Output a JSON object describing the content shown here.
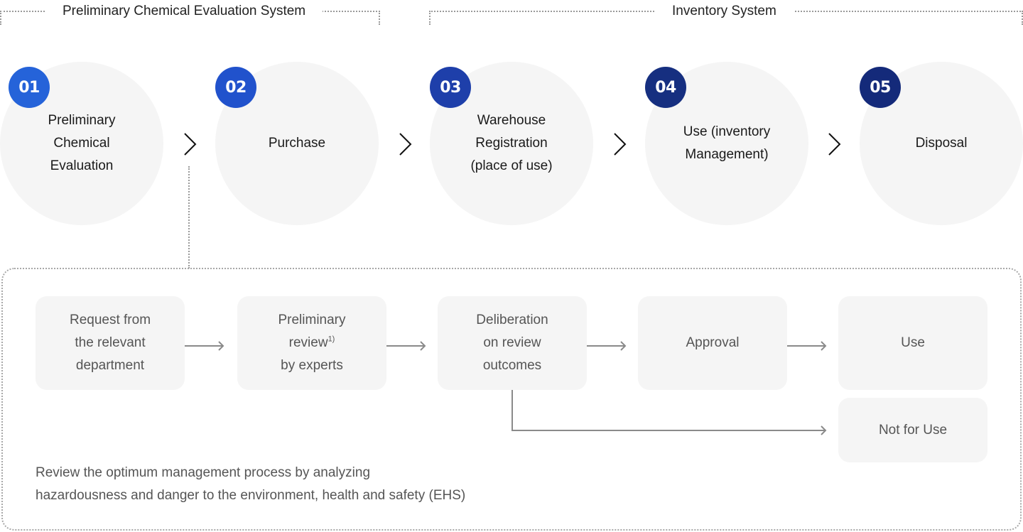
{
  "brackets": {
    "preliminary_system": "Preliminary Chemical Evaluation System",
    "inventory_system": "Inventory System"
  },
  "steps": [
    {
      "number": "01",
      "label": "Preliminary\nChemical\nEvaluation",
      "badge_color": "#2563d9"
    },
    {
      "number": "02",
      "label": "Purchase",
      "badge_color": "#2152cc"
    },
    {
      "number": "03",
      "label": "Warehouse\nRegistration\n(place of use)",
      "badge_color": "#1e3faa"
    },
    {
      "number": "04",
      "label": "Use (inventory\nManagement)",
      "badge_color": "#162f80"
    },
    {
      "number": "05",
      "label": "Disposal",
      "badge_color": "#142a7a"
    }
  ],
  "sub_process": {
    "boxes": [
      {
        "label": "Request from\nthe relevant\ndepartment"
      },
      {
        "label_pre": "Preliminary\nreview",
        "superscript": "1)",
        "label_post": "\nby experts"
      },
      {
        "label": "Deliberation\non review\noutcomes"
      },
      {
        "label": "Approval"
      },
      {
        "label": "Use"
      },
      {
        "label": "Not for Use"
      }
    ],
    "note_line1": "Review the optimum management process by analyzing",
    "note_line2": "hazardousness and danger to the environment, health and safety (EHS)"
  },
  "colors": {
    "circle_bg": "#f5f5f5",
    "box_bg": "#f5f5f5",
    "arrow": "#8a8a8a",
    "dotted": "#9a9a9a"
  }
}
